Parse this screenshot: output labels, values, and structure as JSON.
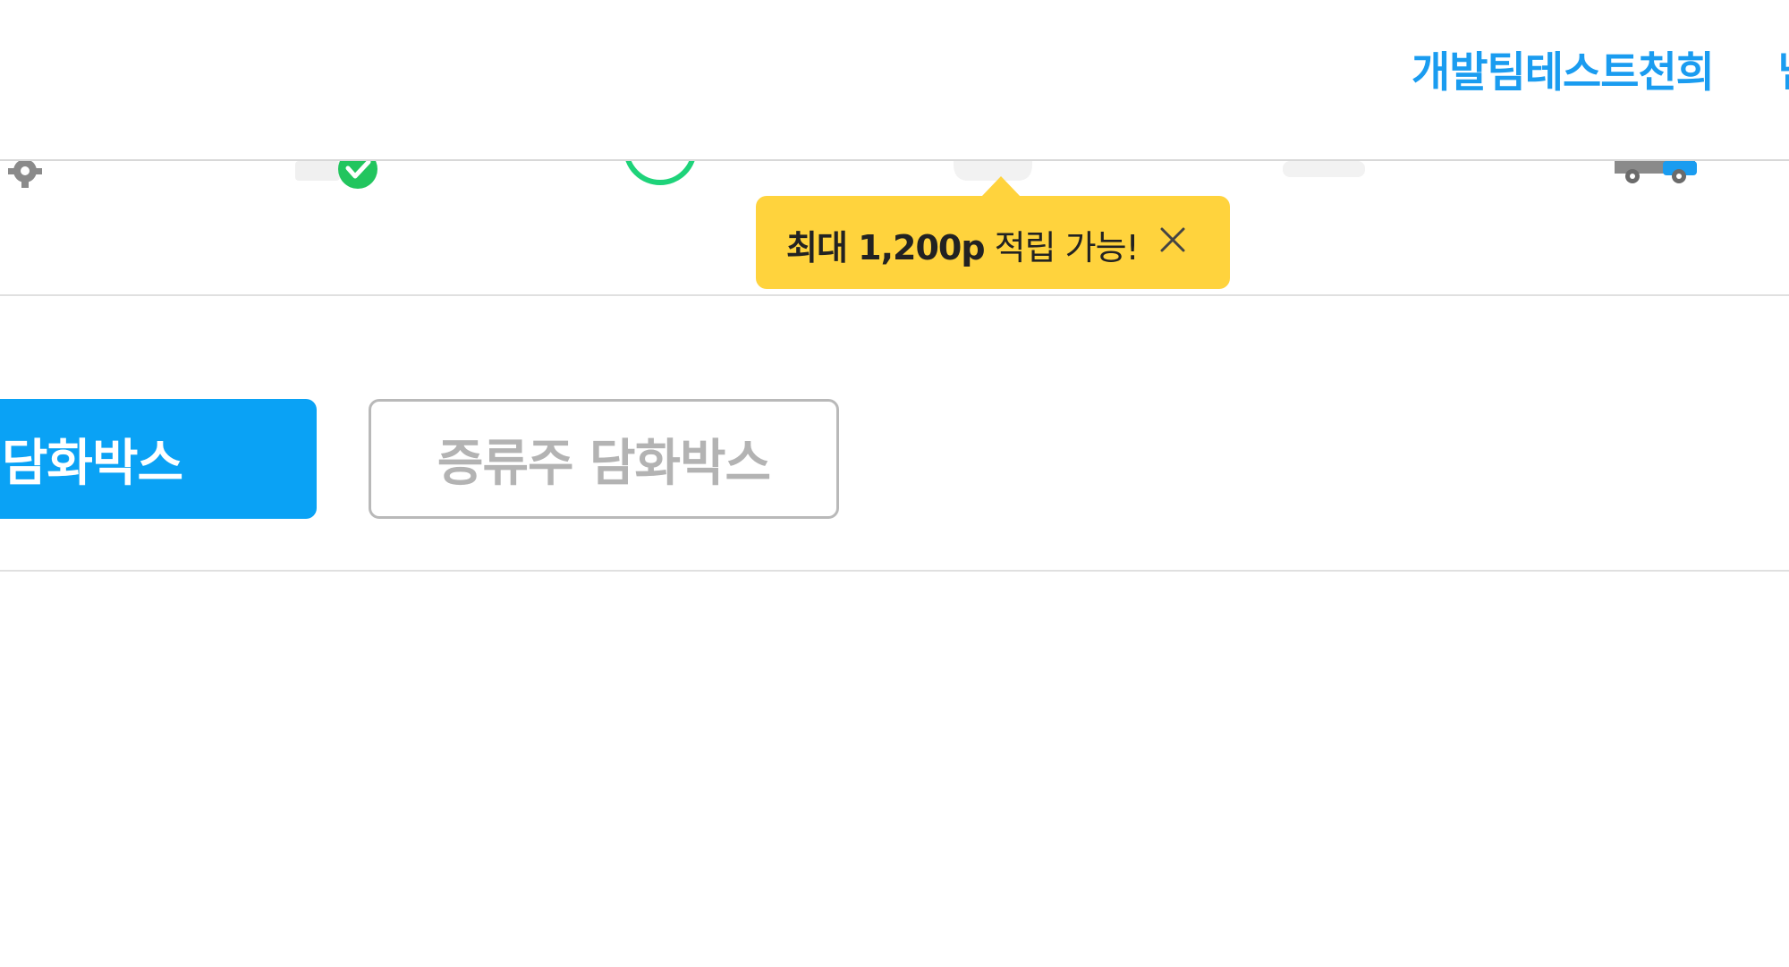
{
  "header": {
    "user_name": "개발팀테스트천희",
    "user_name_cut": "님"
  },
  "icons": [
    "gear-icon",
    "truck-check-icon",
    "circle-icon",
    "box-icon",
    "flat-icon",
    "truck-icon"
  ],
  "tooltip": {
    "highlight": "최대 1,200p",
    "message": " 적립 가능!",
    "close_icon": "close-icon"
  },
  "tabs": [
    {
      "label": "담화박스",
      "state": "active"
    },
    {
      "label": "증류주 담화박스",
      "state": "inactive"
    }
  ],
  "colors": {
    "accent": "#0aa2f5",
    "name_text": "#1a9cf0",
    "tooltip": "#ffd33d",
    "check_green": "#22c55e",
    "circle_green": "#1ed37a",
    "inactive_text": "#b3b3b3"
  }
}
